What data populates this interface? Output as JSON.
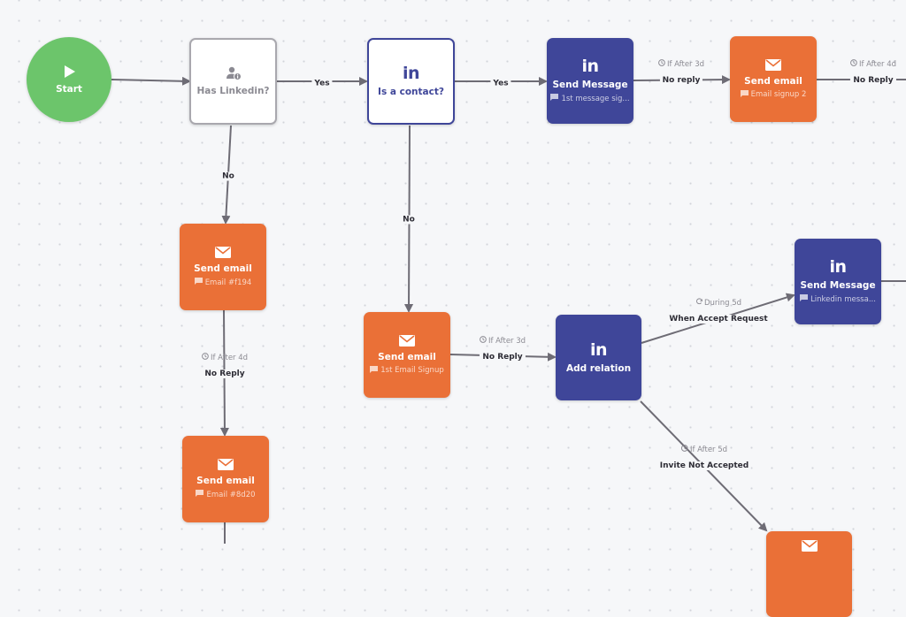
{
  "colors": {
    "start": "#6cc56b",
    "linkedin": "#3f4699",
    "email": "#ea7037",
    "edge": "#6e6c75",
    "condition_border": "#a9a8ae"
  },
  "nodes": {
    "start": {
      "title": "Start",
      "icon": "play-icon"
    },
    "has_linkedin": {
      "title": "Has Linkedin?",
      "icon": "user-info-icon"
    },
    "is_contact": {
      "title": "Is a contact?",
      "icon": "linkedin-icon"
    },
    "send_message_1": {
      "title": "Send Message",
      "subtitle": "1st message sig...",
      "icon": "linkedin-icon"
    },
    "send_email_signup2": {
      "title": "Send email",
      "subtitle": "Email signup 2",
      "icon": "envelope-icon"
    },
    "send_email_f194": {
      "title": "Send email",
      "subtitle": "Email #f194",
      "icon": "envelope-icon"
    },
    "send_email_8d20": {
      "title": "Send email",
      "subtitle": "Email #8d20",
      "icon": "envelope-icon"
    },
    "send_email_1st_signup": {
      "title": "Send email",
      "subtitle": "1st Email Signup",
      "icon": "envelope-icon"
    },
    "add_relation": {
      "title": "Add relation",
      "icon": "linkedin-icon"
    },
    "send_message_2": {
      "title": "Send Message",
      "subtitle": "Linkedin messa...",
      "icon": "linkedin-icon"
    },
    "send_email_bottom": {
      "title": "",
      "icon": "envelope-icon"
    }
  },
  "edges": {
    "start_to_has_linkedin": {
      "label": ""
    },
    "has_linkedin_yes": {
      "label": "Yes"
    },
    "is_contact_yes": {
      "label": "Yes"
    },
    "msg1_no_reply": {
      "condition": "If After 3d",
      "label": "No reply"
    },
    "email2_no_reply": {
      "condition": "If After 4d",
      "label": "No Reply"
    },
    "has_linkedin_no": {
      "label": "No"
    },
    "is_contact_no": {
      "label": "No"
    },
    "f194_no_reply": {
      "condition": "If After 4d",
      "label": "No Reply"
    },
    "signup_no_reply": {
      "condition": "If After 3d",
      "label": "No Reply"
    },
    "accept_request": {
      "condition": "During 5d",
      "label": "When Accept Request",
      "condition_icon": "refresh-icon"
    },
    "invite_not_accepted": {
      "condition": "If After 5d",
      "label": "Invite Not Accepted"
    }
  }
}
